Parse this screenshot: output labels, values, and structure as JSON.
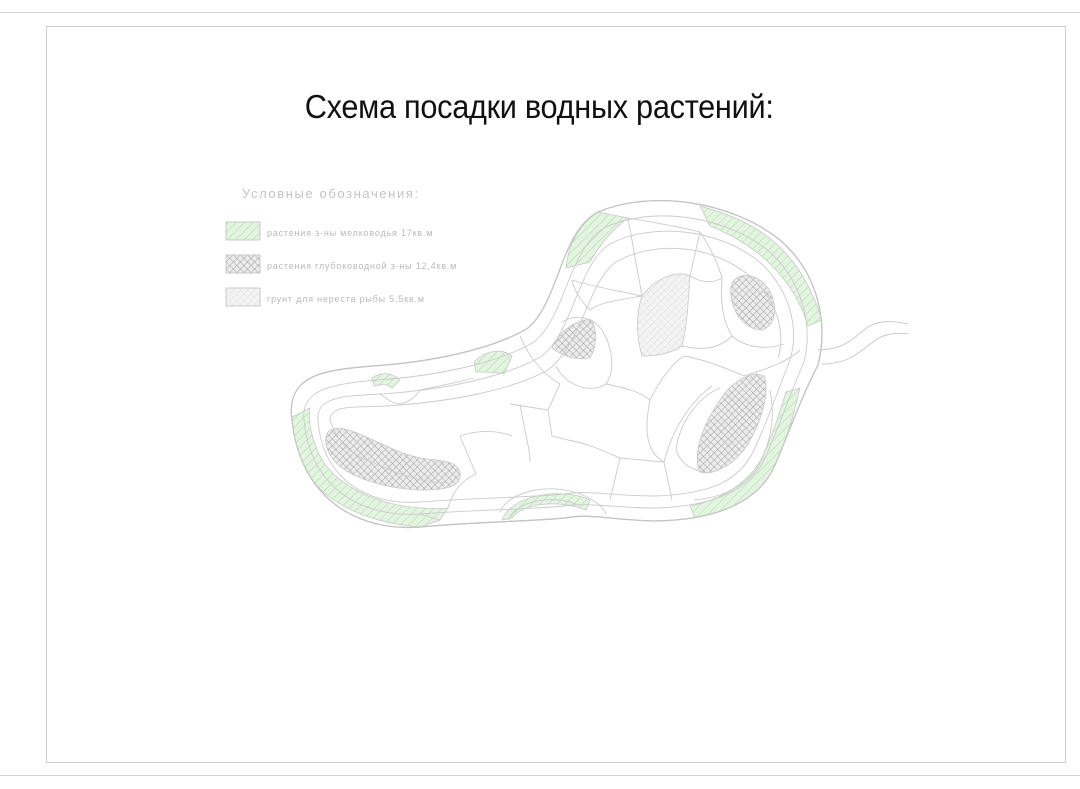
{
  "title": "Схема посадки водных растений:",
  "legend": {
    "title": "Условные обозначения:",
    "items": [
      {
        "label": "растения з-ны мелководья 17кв.м",
        "pattern": "shallow"
      },
      {
        "label": "растения глубоководной з-ны 12,4кв.м",
        "pattern": "deep"
      },
      {
        "label": "грунт для нереста рыбы 5,5кв.м",
        "pattern": "spawning"
      }
    ]
  },
  "colors": {
    "shallow_fill": "#e3f4e1",
    "shallow_hatch": "#a9d9a3",
    "deep_fill": "#e8e8e8",
    "deep_hatch": "#8e8e8e",
    "spawning_fill": "#f3f3f3",
    "spawning_hatch": "#d0d0d0",
    "line": "#c9c9c9"
  }
}
